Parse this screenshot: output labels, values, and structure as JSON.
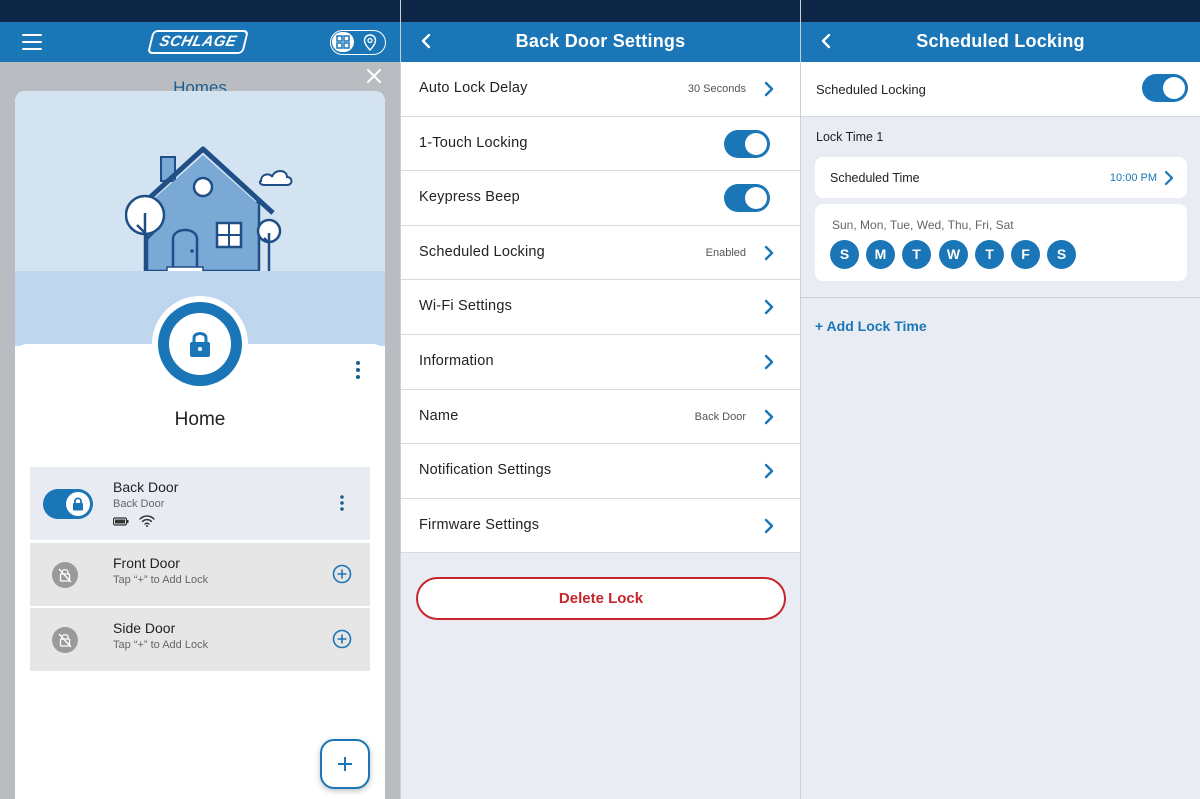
{
  "panel1": {
    "logo_text": "SCHLAGE",
    "homes_title": "Homes",
    "home_name": "Home",
    "locks": [
      {
        "name": "Back Door",
        "subtitle": "Back Door"
      },
      {
        "name": "Front Door",
        "subtitle": "Tap “+” to Add Lock"
      },
      {
        "name": "Side Door",
        "subtitle": "Tap “+” to Add Lock"
      }
    ],
    "icons": {
      "menu": "hamburger-icon",
      "close": "close-icon",
      "add": "plus-icon"
    }
  },
  "panel2": {
    "title": "Back Door Settings",
    "rows": [
      {
        "label": "Auto Lock Delay",
        "value": "30 Seconds"
      },
      {
        "label": "1-Touch Locking"
      },
      {
        "label": "Keypress Beep"
      },
      {
        "label": "Scheduled Locking",
        "value": "Enabled"
      },
      {
        "label": "Wi-Fi Settings"
      },
      {
        "label": "Information"
      },
      {
        "label": "Name",
        "value": "Back Door"
      },
      {
        "label": "Notification Settings"
      },
      {
        "label": "Firmware Settings"
      }
    ],
    "delete_label": "Delete Lock"
  },
  "panel3": {
    "title": "Scheduled Locking",
    "toggle_label": "Scheduled Locking",
    "lock_time_label": "Lock Time 1",
    "scheduled_time_label": "Scheduled Time",
    "scheduled_time_value": "10:00 PM",
    "days_text": "Sun, Mon, Tue, Wed, Thu, Fri, Sat",
    "days": [
      "S",
      "M",
      "T",
      "W",
      "T",
      "F",
      "S"
    ],
    "add_lock_time": "+ Add Lock Time"
  },
  "colors": {
    "primary": "#1a76b6",
    "danger": "#c6252b",
    "background": "#e9edf3"
  }
}
